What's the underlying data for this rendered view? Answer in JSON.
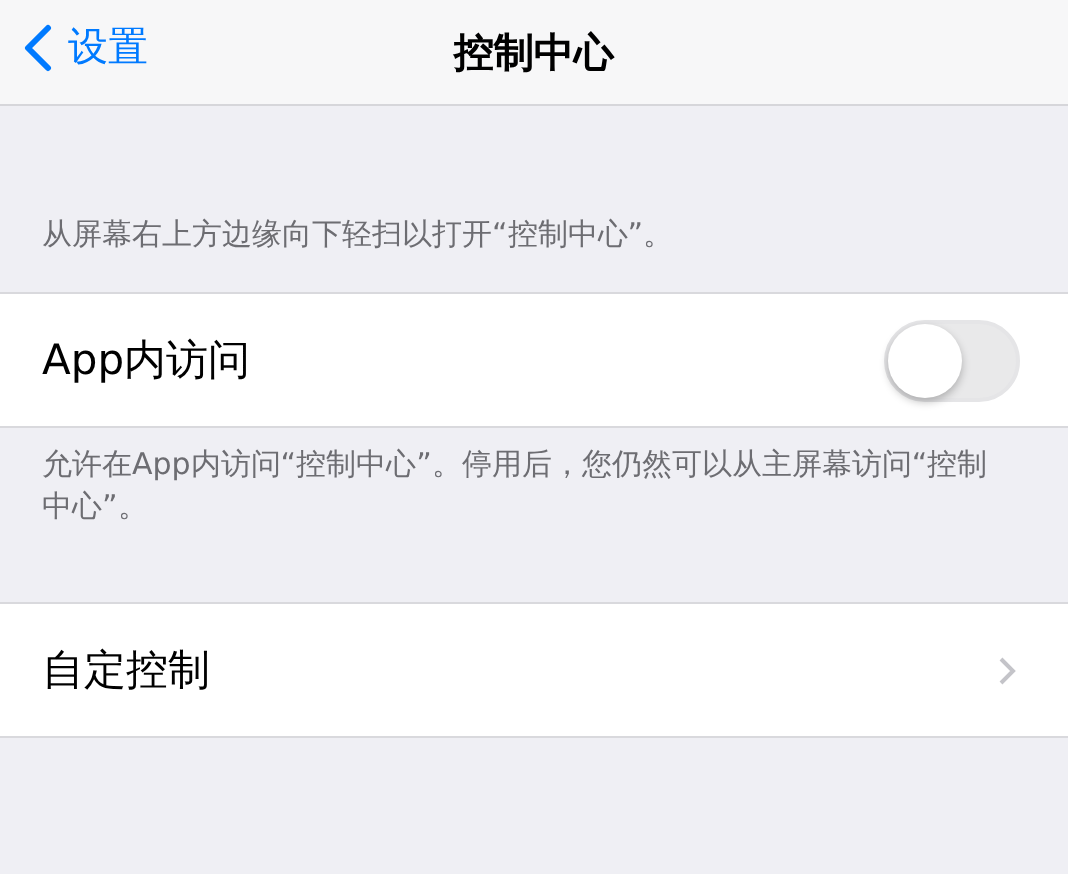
{
  "nav": {
    "back": "设置",
    "title": "控制中心"
  },
  "sections": [
    {
      "header": "从屏幕右上方边缘向下轻扫以打开“控制中心”。",
      "row": {
        "kind": "toggle",
        "label": "App内访问",
        "on": false
      },
      "footer": "允许在App内访问“控制中心”。停用后，您仍然可以从主屏幕访问“控制中心”。"
    },
    {
      "row": {
        "kind": "link",
        "label": "自定控制"
      }
    }
  ]
}
